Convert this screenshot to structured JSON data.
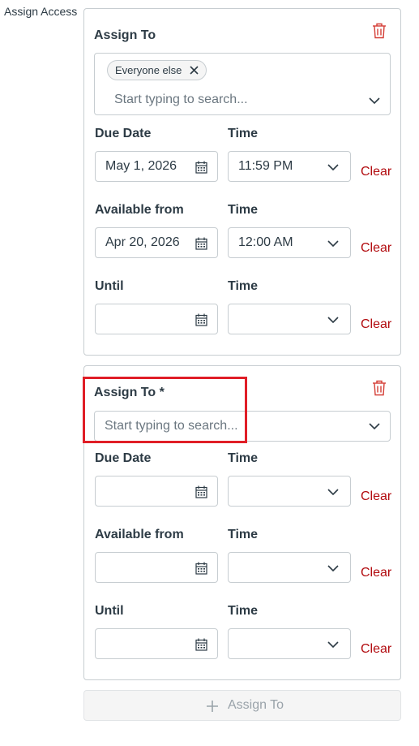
{
  "section_label": "Assign Access",
  "cards": [
    {
      "assign_to_label": "Assign To",
      "selected_tag": "Everyone else",
      "search_placeholder": "Start typing to search...",
      "rows": [
        {
          "date_label": "Due Date",
          "time_label": "Time",
          "date_value": "May 1, 2026",
          "time_value": "11:59 PM",
          "clear": "Clear"
        },
        {
          "date_label": "Available from",
          "time_label": "Time",
          "date_value": "Apr 20, 2026",
          "time_value": "12:00 AM",
          "clear": "Clear"
        },
        {
          "date_label": "Until",
          "time_label": "Time",
          "date_value": "",
          "time_value": "",
          "clear": "Clear"
        }
      ]
    },
    {
      "assign_to_label": "Assign To *",
      "search_placeholder": "Start typing to search...",
      "rows": [
        {
          "date_label": "Due Date",
          "time_label": "Time",
          "date_value": "",
          "time_value": "",
          "clear": "Clear"
        },
        {
          "date_label": "Available from",
          "time_label": "Time",
          "date_value": "",
          "time_value": "",
          "clear": "Clear"
        },
        {
          "date_label": "Until",
          "time_label": "Time",
          "date_value": "",
          "time_value": "",
          "clear": "Clear"
        }
      ]
    }
  ],
  "add_button_label": "Assign To",
  "colors": {
    "clear": "#b20b0f",
    "highlight": "#e01e27",
    "trash": "#d43d35"
  },
  "icons": [
    "trash-icon",
    "close-icon",
    "chevron-down-icon",
    "calendar-icon",
    "plus-icon"
  ]
}
